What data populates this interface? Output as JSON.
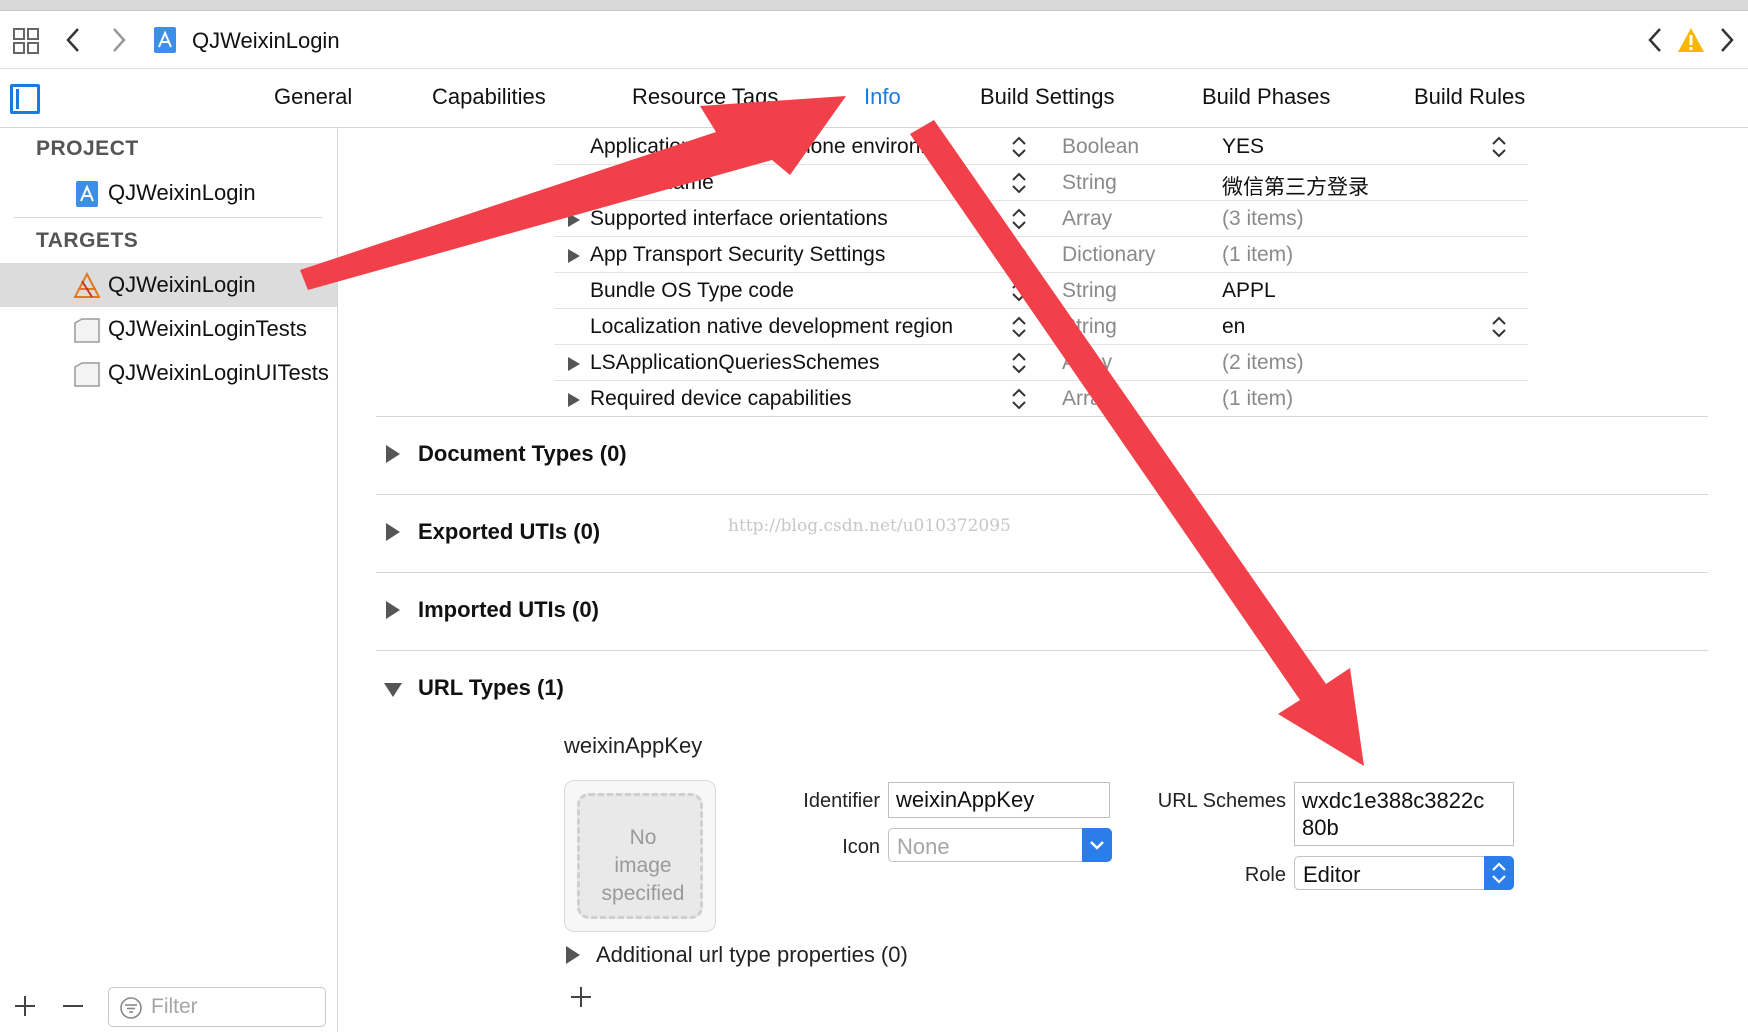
{
  "toolbar": {
    "crumb_title": "QJWeixinLogin"
  },
  "tabs": [
    {
      "label": "General"
    },
    {
      "label": "Capabilities"
    },
    {
      "label": "Resource Tags"
    },
    {
      "label": "Info"
    },
    {
      "label": "Build Settings"
    },
    {
      "label": "Build Phases"
    },
    {
      "label": "Build Rules"
    }
  ],
  "active_tab": "Info",
  "sidebar": {
    "project_header": "PROJECT",
    "targets_header": "TARGETS",
    "project_item": "QJWeixinLogin",
    "targets": [
      {
        "label": "QJWeixinLogin"
      },
      {
        "label": "QJWeixinLoginTests"
      },
      {
        "label": "QJWeixinLoginUITests"
      }
    ],
    "filter_placeholder": "Filter"
  },
  "plist": {
    "rows": [
      {
        "key": "Application requires iPhone environm...",
        "type": "Boolean",
        "value": "YES"
      },
      {
        "key": "Bundle name",
        "type": "String",
        "value": "微信第三方登录"
      },
      {
        "key": "Supported interface orientations",
        "type": "Array",
        "value": "(3 items)"
      },
      {
        "key": "App Transport Security Settings",
        "type": "Dictionary",
        "value": "(1 item)"
      },
      {
        "key": "Bundle OS Type code",
        "type": "String",
        "value": "APPL"
      },
      {
        "key": "Localization native development region",
        "type": "String",
        "value": "en"
      },
      {
        "key": "LSApplicationQueriesSchemes",
        "type": "Array",
        "value": "(2 items)"
      },
      {
        "key": "Required device capabilities",
        "type": "Array",
        "value": "(1 item)"
      }
    ]
  },
  "sections": {
    "document_types": "Document Types (0)",
    "exported_utis": "Exported UTIs (0)",
    "imported_utis": "Imported UTIs (0)",
    "url_types": "URL Types (1)"
  },
  "watermark": "http://blog.csdn.net/u010372095",
  "url_type": {
    "name": "weixinAppKey",
    "no_image": [
      "No",
      "image",
      "specified"
    ],
    "identifier_label": "Identifier",
    "identifier_value": "weixinAppKey",
    "icon_label": "Icon",
    "icon_placeholder": "None",
    "url_schemes_label": "URL Schemes",
    "url_schemes_value_line1": "wxdc1e388c3822c",
    "url_schemes_value_line2": "80b",
    "role_label": "Role",
    "role_value": "Editor",
    "additional_properties": "Additional url type properties (0)"
  },
  "colors": {
    "accent": "#1a7ae0",
    "arrow": "#f2404a",
    "warning": "#f5b800"
  }
}
